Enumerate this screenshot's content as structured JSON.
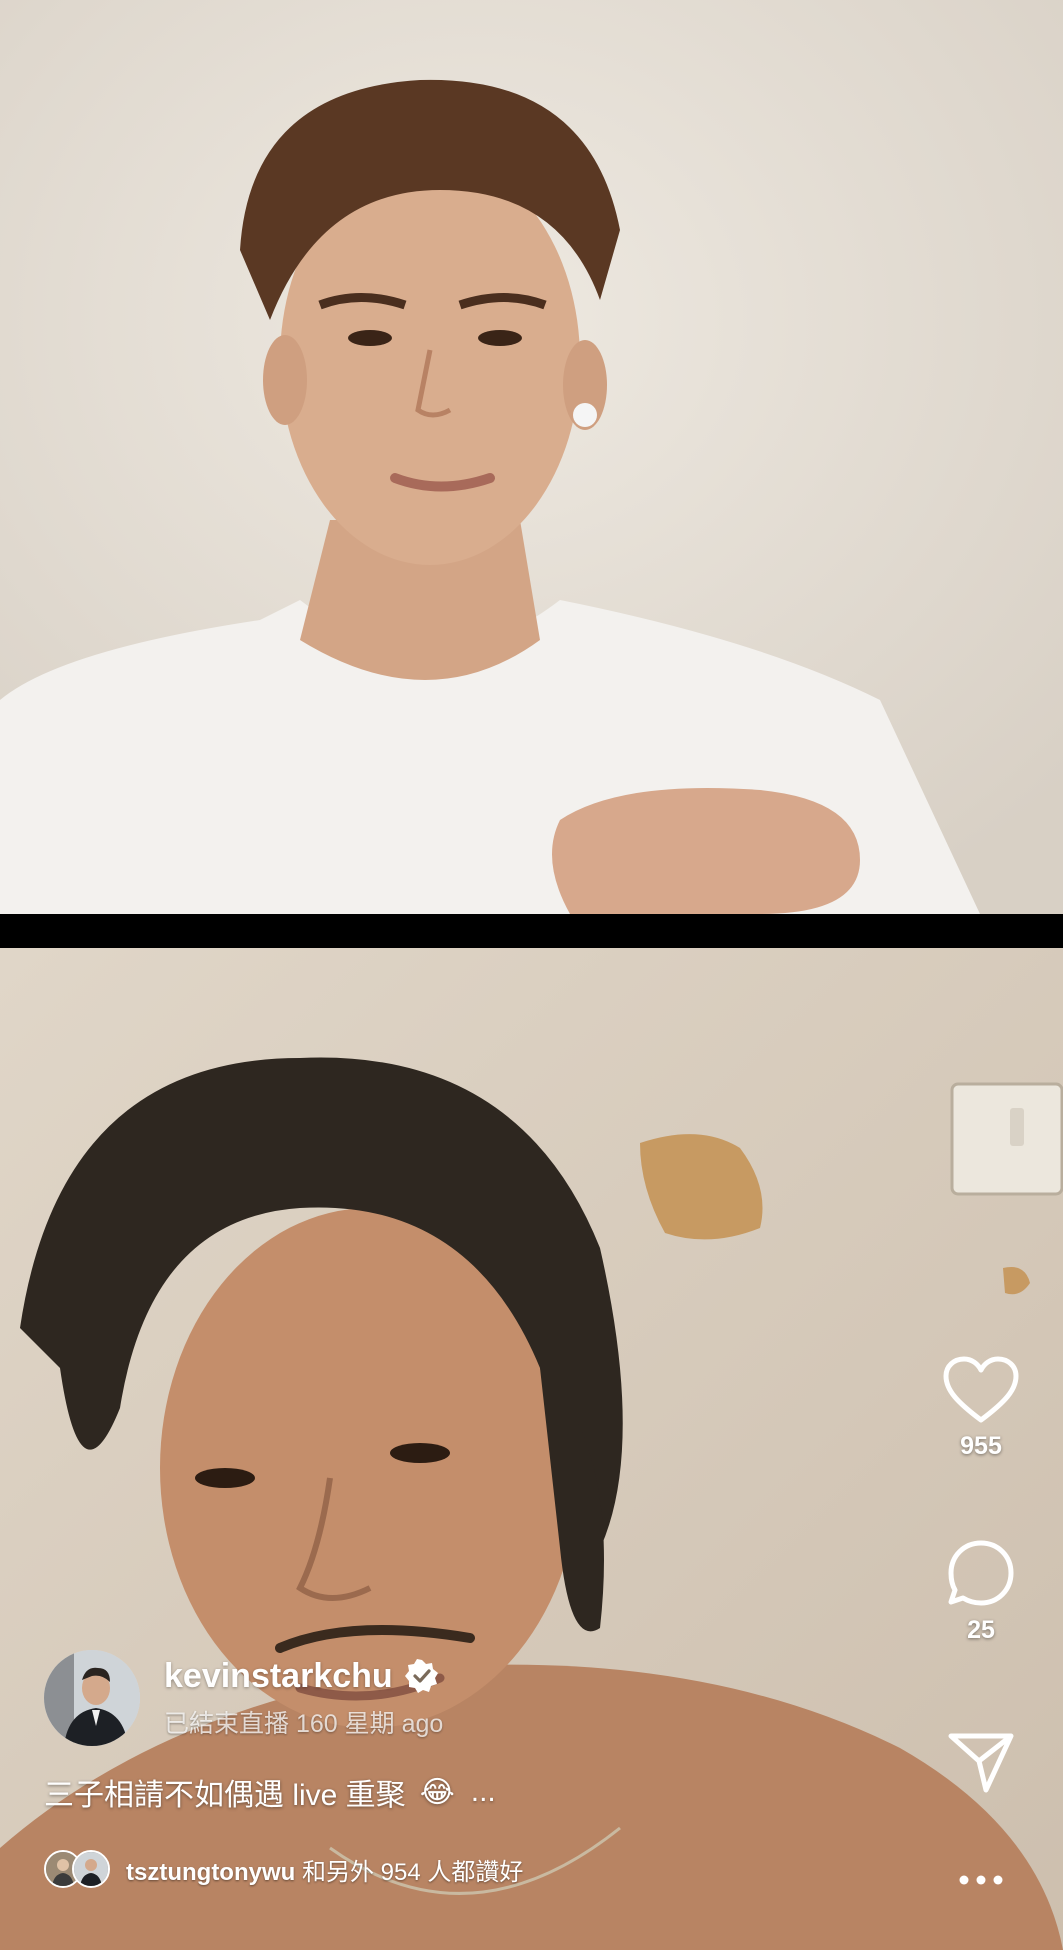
{
  "post": {
    "username": "kevinstarkchu",
    "status_text": "已結束直播",
    "time_text": "160 星期 ago",
    "caption": "三子相請不如偶遇 live 重聚",
    "caption_emoji": "😂",
    "caption_more": "...",
    "liked_by_user": "tsztungtonywu",
    "liked_by_suffix": "和另外 954 人都讚好"
  },
  "actions": {
    "like_count": "955",
    "comment_count": "25"
  },
  "icons": {
    "like": "heart-icon",
    "comment": "comment-bubble-icon",
    "share": "paper-plane-icon",
    "more": "more-dots-icon",
    "verified": "verified-badge-icon"
  },
  "colors": {
    "overlay_text": "#ffffff",
    "verified_badge": "#ffffff",
    "divider": "#000000"
  }
}
